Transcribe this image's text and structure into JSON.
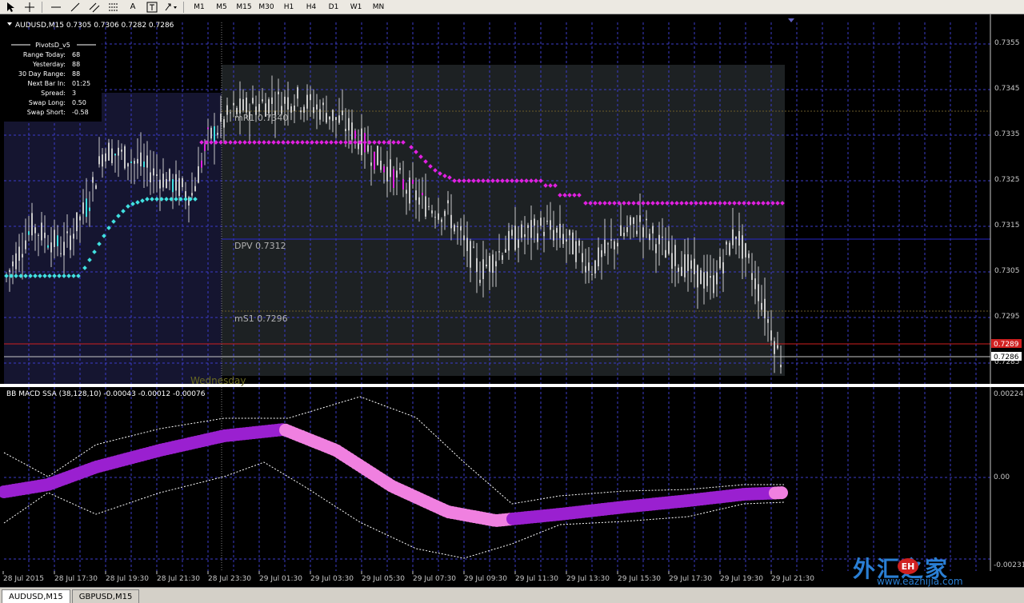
{
  "toolbar": {
    "icons": [
      "cursor-icon",
      "crosshair-icon",
      "hline-icon",
      "trendline-icon",
      "channel-icon",
      "fibo-icon",
      "text-icon",
      "label-icon",
      "shapes-dropdown-icon"
    ],
    "text_label": "A",
    "timeframes": [
      "M1",
      "M5",
      "M15",
      "M30",
      "H1",
      "H4",
      "D1",
      "W1",
      "MN"
    ]
  },
  "chart": {
    "header": "AUDUSD,M15  0.7305 0.7306 0.7282 0.7286",
    "pivots_panel": {
      "title": "PivotsD_v5",
      "rows": [
        {
          "label": "Range  Today:",
          "value": "68"
        },
        {
          "label": "Yesterday:",
          "value": "88"
        },
        {
          "label": "30 Day Range:",
          "value": "88"
        },
        {
          "label": "Next Bar In:",
          "value": "01:25"
        },
        {
          "label": "Spread:",
          "value": "3"
        },
        {
          "label": "Swap  Long:",
          "value": "0.50"
        },
        {
          "label": "Swap  Short:",
          "value": "-0.58"
        }
      ]
    },
    "levels": {
      "mr1": "mR1  0.7340",
      "dpv": "DPV  0.7312",
      "ms1": "mS1  0.7296"
    },
    "day_label": "Wednesday",
    "price_axis": [
      "0.7355",
      "0.7345",
      "0.7335",
      "0.7325",
      "0.7315",
      "0.7305",
      "0.7295",
      "0.7285"
    ],
    "price_markers": {
      "red": "0.7289",
      "current": "0.7286"
    },
    "indicator_header": "BB MACD SSA (38,128,10) -0.00043 -0.00012 -0.00076",
    "indicator_axis": [
      "0.00224",
      "0.00",
      "-0.00231"
    ],
    "time_axis": [
      "28 Jul 2015",
      "28 Jul 17:30",
      "28 Jul 19:30",
      "28 Jul 21:30",
      "28 Jul 23:30",
      "29 Jul 01:30",
      "29 Jul 03:30",
      "29 Jul 05:30",
      "29 Jul 07:30",
      "29 Jul 09:30",
      "29 Jul 11:30",
      "29 Jul 13:30",
      "29 Jul 15:30",
      "29 Jul 17:30",
      "29 Jul 19:30",
      "29 Jul 21:30"
    ]
  },
  "tabs": [
    "AUDUSD,M15",
    "GBPUSD,M15"
  ],
  "watermark": {
    "cn": "外汇之家",
    "badge": "EH",
    "url": "www.eazhijia.com"
  },
  "colors": {
    "background": "#000000",
    "grid": "#3c3cc8",
    "candle": "#c8c8c8",
    "pivot_dots_up": "#40e0e0",
    "pivot_dots_down": "#e020e0",
    "macd_dark": "#9a20d0",
    "macd_light": "#f080e0",
    "bands": "#ffffff"
  }
}
